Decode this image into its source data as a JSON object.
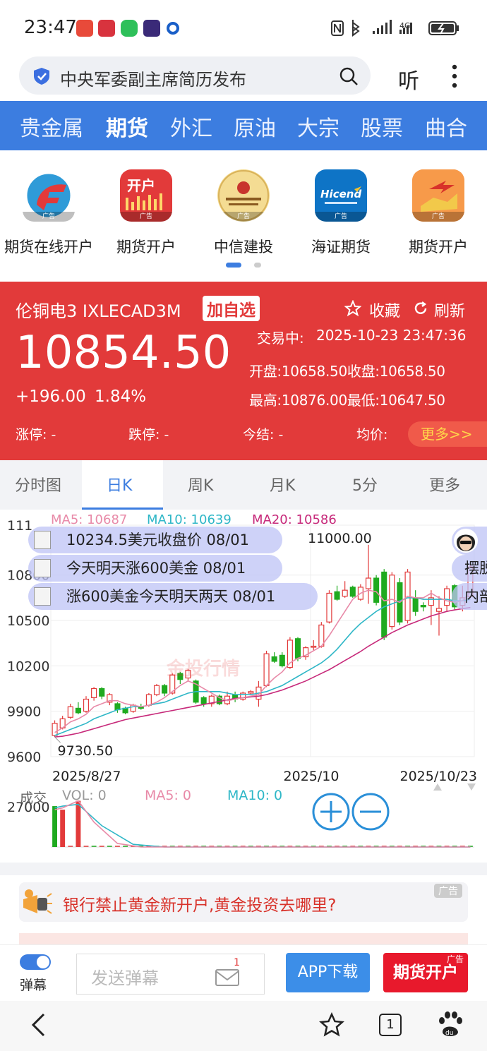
{
  "status_bar": {
    "time": "23:47"
  },
  "search": {
    "placeholder": "中央军委副主席简历发布",
    "listen_label": "听"
  },
  "category_tabs": [
    {
      "label": "贵金属"
    },
    {
      "label": "期货",
      "active": true
    },
    {
      "label": "外汇"
    },
    {
      "label": "原油"
    },
    {
      "label": "大宗"
    },
    {
      "label": "股票"
    },
    {
      "label": "曲合"
    }
  ],
  "app_ads": [
    {
      "label": "期货在线开户",
      "icon": "futures-online-logo-icon"
    },
    {
      "label": "期货开户",
      "icon": "kaihu-chart-icon"
    },
    {
      "label": "中信建投",
      "icon": "citic-futures-logo-icon"
    },
    {
      "label": "海证期货",
      "icon": "hicend-logo-icon"
    },
    {
      "label": "期货开户",
      "icon": "gold-bars-icon"
    }
  ],
  "ad_tag": "广告",
  "quote": {
    "name": "伦铜电3 IXLECAD3M",
    "add_watch": "加自选",
    "favorite": "收藏",
    "refresh": "刷新",
    "price": "10854.50",
    "change": "+196.00",
    "change_pct": "1.84%",
    "trading_status": "交易中:",
    "datetime": "2025-10-23 23:47:36",
    "open_close": "开盘:10658.50收盘:10658.50",
    "high_low": "最高:10876.00最低:10647.50",
    "limit_up": "涨停: -",
    "limit_down": "跌停: -",
    "settle": "今结: -",
    "avg": "均价:",
    "more": "更多>>"
  },
  "kline_tabs": [
    {
      "label": "分时图"
    },
    {
      "label": "日K",
      "active": true
    },
    {
      "label": "周K"
    },
    {
      "label": "月K"
    },
    {
      "label": "5分"
    },
    {
      "label": "更多"
    }
  ],
  "ma_labels": {
    "ma5": "MA5: 10687",
    "ma10": "MA10: 10639",
    "ma20": "MA20: 10586"
  },
  "danmu": [
    {
      "text": "10234.5美元收盘价 08/01"
    },
    {
      "text": "今天明天涨600美金 08/01"
    },
    {
      "text": "涨600美金今天明天两天 08/01"
    },
    {
      "text": "摆脱"
    },
    {
      "text": "内部"
    }
  ],
  "chart_data": {
    "type": "candlestick",
    "y_ticks": [
      "111",
      "10800",
      "10500",
      "10200",
      "9900",
      "9600"
    ],
    "x_ticks": [
      "2025/8/27",
      "2025/10",
      "2025/10/23"
    ],
    "max_label": "11000.00",
    "min_label": "9730.50",
    "ylim": [
      9600,
      11130
    ],
    "candles": [
      {
        "o": 9740,
        "c": 9820,
        "h": 9840,
        "l": 9730
      },
      {
        "o": 9790,
        "c": 9850,
        "h": 9870,
        "l": 9780
      },
      {
        "o": 9860,
        "c": 9930,
        "h": 9950,
        "l": 9850
      },
      {
        "o": 9920,
        "c": 9890,
        "h": 9960,
        "l": 9880
      },
      {
        "o": 9900,
        "c": 9980,
        "h": 10000,
        "l": 9890
      },
      {
        "o": 9990,
        "c": 10050,
        "h": 10060,
        "l": 9970
      },
      {
        "o": 10050,
        "c": 10000,
        "h": 10060,
        "l": 9980
      },
      {
        "o": 9960,
        "c": 10010,
        "h": 10020,
        "l": 9940
      },
      {
        "o": 9950,
        "c": 9910,
        "h": 9960,
        "l": 9890
      },
      {
        "o": 9920,
        "c": 9890,
        "h": 9930,
        "l": 9880
      },
      {
        "o": 9900,
        "c": 9940,
        "h": 9950,
        "l": 9890
      },
      {
        "o": 9930,
        "c": 9920,
        "h": 9950,
        "l": 9910
      },
      {
        "o": 9940,
        "c": 10010,
        "h": 10020,
        "l": 9930
      },
      {
        "o": 10010,
        "c": 10070,
        "h": 10080,
        "l": 10000
      },
      {
        "o": 10070,
        "c": 10020,
        "h": 10080,
        "l": 10000
      },
      {
        "o": 10020,
        "c": 10140,
        "h": 10150,
        "l": 10010
      },
      {
        "o": 10150,
        "c": 10110,
        "h": 10160,
        "l": 10080
      },
      {
        "o": 10120,
        "c": 10170,
        "h": 10180,
        "l": 10100
      },
      {
        "o": 10100,
        "c": 9960,
        "h": 10110,
        "l": 9950
      },
      {
        "o": 9990,
        "c": 9950,
        "h": 10000,
        "l": 9930
      },
      {
        "o": 9950,
        "c": 10000,
        "h": 10010,
        "l": 9930
      },
      {
        "o": 10000,
        "c": 9950,
        "h": 10010,
        "l": 9940
      },
      {
        "o": 9950,
        "c": 10000,
        "h": 10030,
        "l": 9940
      },
      {
        "o": 10010,
        "c": 9980,
        "h": 10030,
        "l": 9960
      },
      {
        "o": 9980,
        "c": 10020,
        "h": 10030,
        "l": 9970
      },
      {
        "o": 10020,
        "c": 10030,
        "h": 10040,
        "l": 10010
      },
      {
        "o": 9980,
        "c": 10060,
        "h": 10100,
        "l": 9930
      },
      {
        "o": 10070,
        "c": 10280,
        "h": 10300,
        "l": 10060
      },
      {
        "o": 10260,
        "c": 10230,
        "h": 10290,
        "l": 10220
      },
      {
        "o": 10270,
        "c": 10200,
        "h": 10290,
        "l": 10190
      },
      {
        "o": 10190,
        "c": 10370,
        "h": 10390,
        "l": 10180
      },
      {
        "o": 10380,
        "c": 10250,
        "h": 10390,
        "l": 10230
      },
      {
        "o": 10260,
        "c": 10320,
        "h": 10330,
        "l": 10240
      },
      {
        "o": 10330,
        "c": 10330,
        "h": 10370,
        "l": 10300
      },
      {
        "o": 10330,
        "c": 10470,
        "h": 10490,
        "l": 10320
      },
      {
        "o": 10490,
        "c": 10680,
        "h": 10700,
        "l": 10480
      },
      {
        "o": 10690,
        "c": 10640,
        "h": 10730,
        "l": 10630
      },
      {
        "o": 10660,
        "c": 10700,
        "h": 10760,
        "l": 10650
      },
      {
        "o": 10720,
        "c": 10660,
        "h": 10730,
        "l": 10650
      },
      {
        "o": 10640,
        "c": 10720,
        "h": 10740,
        "l": 10630
      },
      {
        "o": 10710,
        "c": 10780,
        "h": 11000,
        "l": 10610
      },
      {
        "o": 10780,
        "c": 10620,
        "h": 10800,
        "l": 10600
      },
      {
        "o": 10820,
        "c": 10390,
        "h": 10840,
        "l": 10370
      },
      {
        "o": 10460,
        "c": 10800,
        "h": 10820,
        "l": 10440
      },
      {
        "o": 10750,
        "c": 10490,
        "h": 10780,
        "l": 10470
      },
      {
        "o": 10500,
        "c": 10820,
        "h": 10840,
        "l": 10480
      },
      {
        "o": 10650,
        "c": 10560,
        "h": 10700,
        "l": 10530
      },
      {
        "o": 10600,
        "c": 10590,
        "h": 10620,
        "l": 10560
      },
      {
        "o": 10600,
        "c": 10650,
        "h": 10700,
        "l": 10470
      },
      {
        "o": 10560,
        "c": 10580,
        "h": 10660,
        "l": 10400
      },
      {
        "o": 10600,
        "c": 10710,
        "h": 10730,
        "l": 10560
      },
      {
        "o": 10730,
        "c": 10590,
        "h": 10740,
        "l": 10570
      },
      {
        "o": 10600,
        "c": 10650,
        "h": 10730,
        "l": 10560
      },
      {
        "o": 10658,
        "c": 10854,
        "h": 10876,
        "l": 10647
      }
    ],
    "ma5": [
      9760,
      9790,
      9830,
      9850,
      9880,
      9930,
      9950,
      9970,
      9970,
      9950,
      9940,
      9930,
      9940,
      9960,
      9990,
      10030,
      10070,
      10100,
      10080,
      10050,
      10020,
      9990,
      9970,
      9980,
      9990,
      10000,
      10010,
      10070,
      10120,
      10160,
      10220,
      10250,
      10270,
      10300,
      10330,
      10400,
      10480,
      10560,
      10640,
      10680,
      10700,
      10690,
      10630,
      10640,
      10620,
      10660,
      10650,
      10650,
      10680,
      10650,
      10630,
      10620,
      10630,
      10687
    ],
    "ma10": [
      9740,
      9760,
      9780,
      9800,
      9820,
      9850,
      9870,
      9890,
      9910,
      9920,
      9930,
      9930,
      9940,
      9950,
      9960,
      9980,
      10000,
      10020,
      10030,
      10030,
      10030,
      10030,
      10020,
      10010,
      10010,
      10010,
      10020,
      10030,
      10050,
      10070,
      10100,
      10130,
      10160,
      10190,
      10220,
      10260,
      10310,
      10370,
      10430,
      10480,
      10520,
      10560,
      10590,
      10610,
      10630,
      10650,
      10650,
      10640,
      10640,
      10640,
      10640,
      10630,
      10630,
      10639
    ],
    "ma20": [
      9730,
      9735,
      9745,
      9755,
      9770,
      9785,
      9800,
      9815,
      9830,
      9845,
      9855,
      9865,
      9875,
      9885,
      9895,
      9905,
      9915,
      9925,
      9935,
      9945,
      9955,
      9965,
      9975,
      9985,
      9990,
      9995,
      10000,
      10010,
      10025,
      10040,
      10060,
      10080,
      10100,
      10125,
      10150,
      10175,
      10205,
      10235,
      10265,
      10295,
      10330,
      10360,
      10390,
      10420,
      10445,
      10470,
      10490,
      10510,
      10530,
      10545,
      10560,
      10570,
      10578,
      10586
    ],
    "volume": {
      "label": "成交",
      "vol": "VOL: 0",
      "ma5": "MA5: 0",
      "ma10": "MA10: 0",
      "y_tick": "27000",
      "bars": [
        23000,
        21000,
        0,
        26000,
        0,
        0,
        0,
        0,
        0,
        0,
        0,
        0,
        0,
        0,
        0,
        0,
        0,
        0,
        0,
        0,
        0,
        0,
        0,
        0,
        0,
        0,
        0,
        0,
        0,
        0,
        0,
        0,
        0,
        0,
        0,
        0,
        0,
        0,
        0,
        0,
        0,
        0,
        0,
        0,
        0,
        0,
        0,
        0,
        0,
        0,
        0,
        0,
        0,
        0
      ],
      "bar_up": [
        false,
        true,
        false,
        true
      ]
    }
  },
  "watermark": "金投行情",
  "ad_banner": {
    "text": "银行禁止黄金新开户,黄金投资去哪里?"
  },
  "bottom": {
    "danmu_toggle": "弹幕",
    "input_placeholder": "发送弹幕",
    "badge": "1",
    "download": "APP下载",
    "open_account": "期货开户"
  },
  "nav": {
    "tab_count": "1"
  },
  "colors": {
    "up": "#e23a3a",
    "down": "#1faa1f",
    "brand": "#3c7de0",
    "ma5": "#e88aa8",
    "ma10": "#2fb7c7",
    "ma20": "#c7297a"
  }
}
